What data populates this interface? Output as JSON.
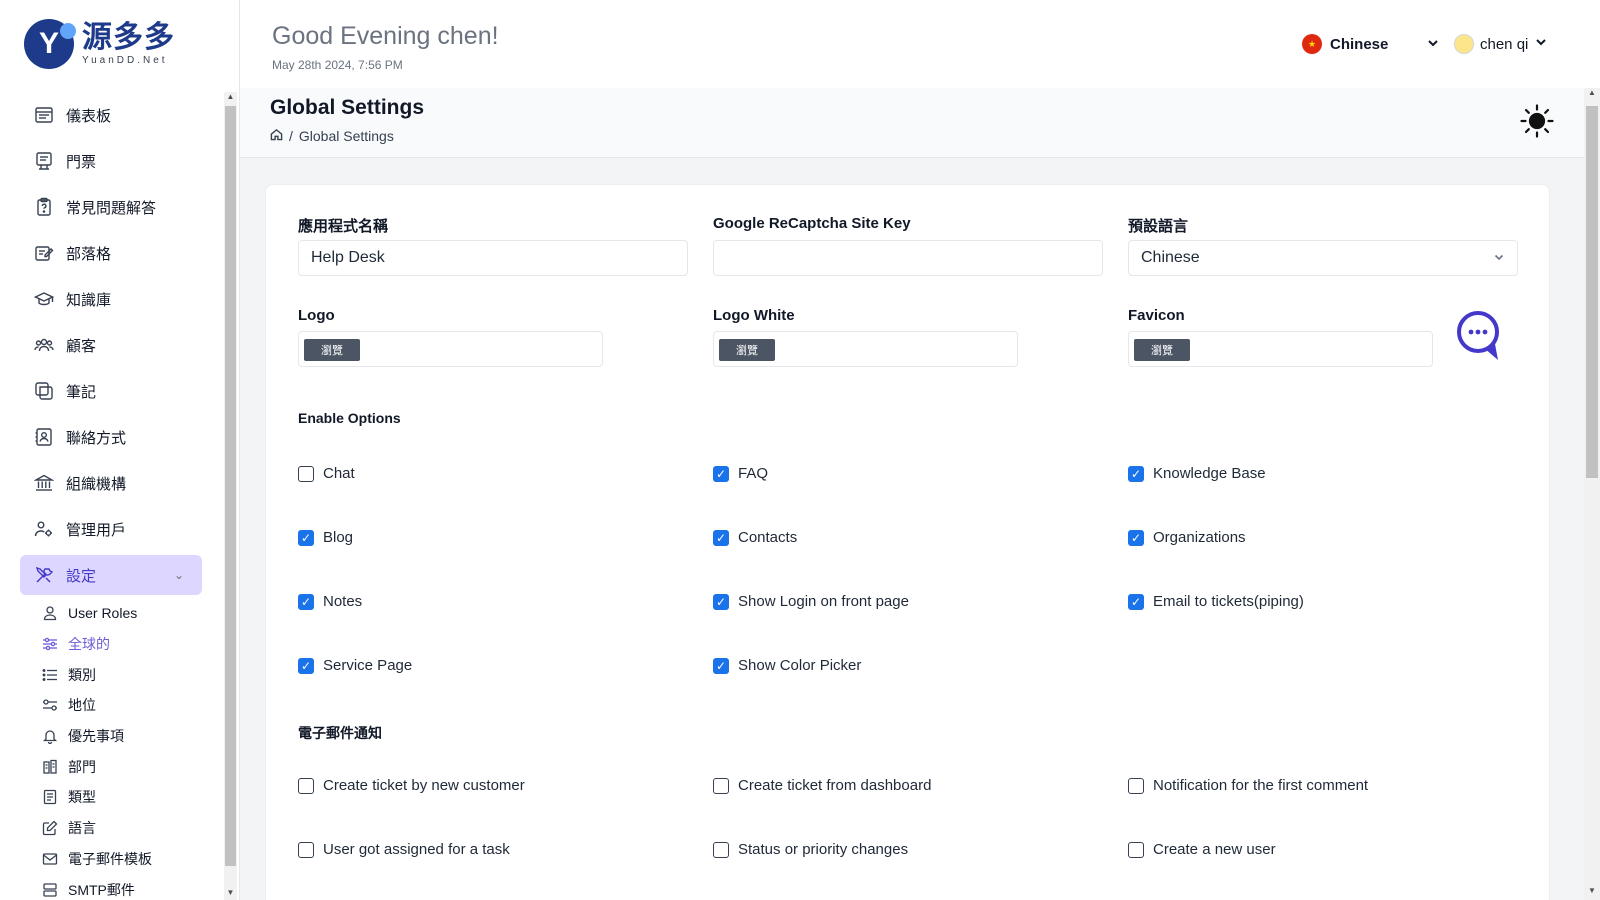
{
  "brand": {
    "wordmark": "源多多",
    "subtext": "YuanDD.Net",
    "initial": "Y"
  },
  "header": {
    "greeting": "Good Evening chen!",
    "datetime": "May 28th 2024, 7:56 PM",
    "language": "Chinese",
    "user_name": "chen qi"
  },
  "sidebar": {
    "items": [
      {
        "label": "儀表板"
      },
      {
        "label": "門票"
      },
      {
        "label": "常見問題解答"
      },
      {
        "label": "部落格"
      },
      {
        "label": "知識庫"
      },
      {
        "label": "顧客"
      },
      {
        "label": "筆記"
      },
      {
        "label": "聯絡方式"
      },
      {
        "label": "組織機構"
      },
      {
        "label": "管理用戶"
      },
      {
        "label": "設定"
      }
    ],
    "sub_items": [
      {
        "label": "User Roles"
      },
      {
        "label": "全球的"
      },
      {
        "label": "類別"
      },
      {
        "label": "地位"
      },
      {
        "label": "優先事項"
      },
      {
        "label": "部門"
      },
      {
        "label": "類型"
      },
      {
        "label": "語言"
      },
      {
        "label": "電子郵件模板"
      },
      {
        "label": "SMTP郵件"
      }
    ]
  },
  "page": {
    "title": "Global Settings",
    "breadcrumb_current": "Global Settings"
  },
  "form": {
    "app_name_label": "應用程式名稱",
    "app_name_value": "Help Desk",
    "recaptcha_label": "Google ReCaptcha Site Key",
    "recaptcha_value": "",
    "default_lang_label": "預設語言",
    "default_lang_value": "Chinese",
    "logo_label": "Logo",
    "logo_white_label": "Logo White",
    "favicon_label": "Favicon",
    "browse_label": "瀏覽"
  },
  "enable_options": {
    "title": "Enable Options",
    "items": [
      {
        "label": "Chat",
        "checked": false
      },
      {
        "label": "FAQ",
        "checked": true
      },
      {
        "label": "Knowledge Base",
        "checked": true
      },
      {
        "label": "Blog",
        "checked": true
      },
      {
        "label": "Contacts",
        "checked": true
      },
      {
        "label": "Organizations",
        "checked": true
      },
      {
        "label": "Notes",
        "checked": true
      },
      {
        "label": "Show Login on front page",
        "checked": true
      },
      {
        "label": "Email to tickets(piping)",
        "checked": true
      },
      {
        "label": "Service Page",
        "checked": true
      },
      {
        "label": "Show Color Picker",
        "checked": true
      }
    ]
  },
  "email_notifications": {
    "title": "電子郵件通知",
    "items": [
      {
        "label": "Create ticket by new customer",
        "checked": false
      },
      {
        "label": "Create ticket from dashboard",
        "checked": false
      },
      {
        "label": "Notification for the first comment",
        "checked": false
      },
      {
        "label": "User got assigned for a task",
        "checked": false
      },
      {
        "label": "Status or priority changes",
        "checked": false
      },
      {
        "label": "Create a new user",
        "checked": false
      }
    ]
  },
  "colors": {
    "accent": "#1a73e8",
    "active_nav_bg": "#ddd6fe",
    "active_nav_text": "#4338ca"
  }
}
